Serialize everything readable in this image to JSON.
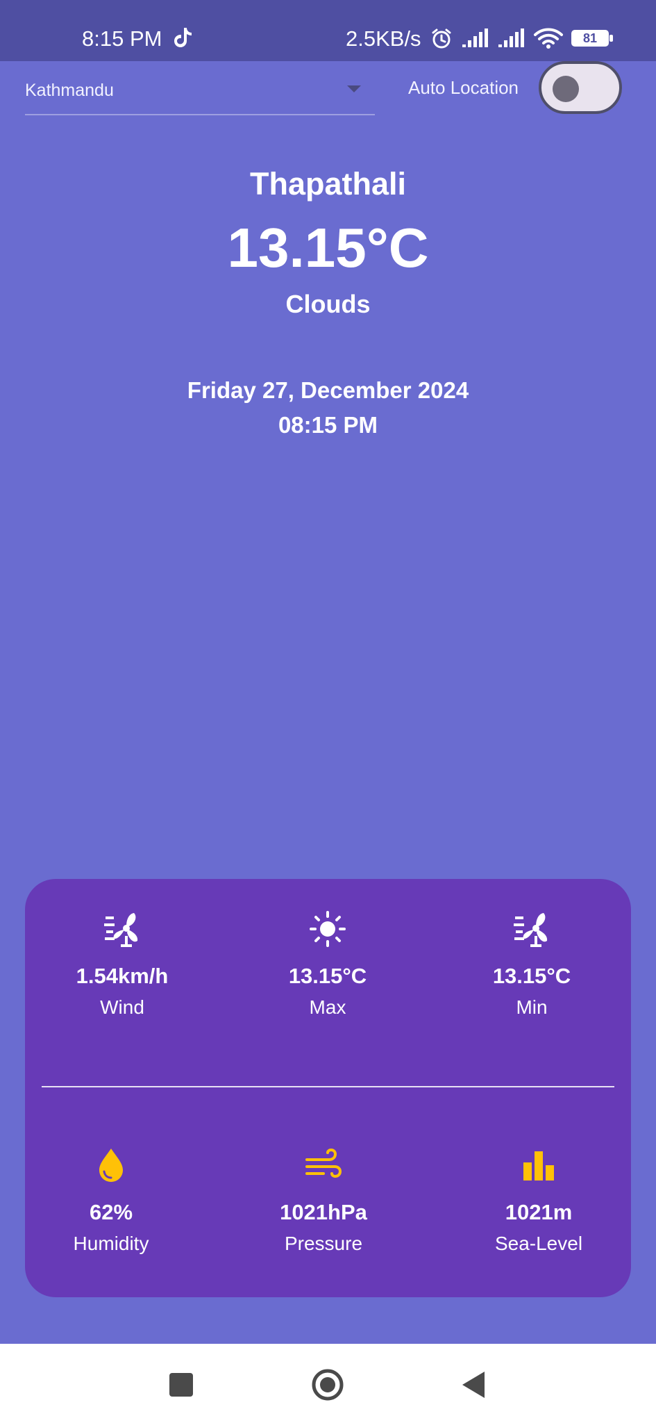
{
  "status_bar": {
    "time": "8:15 PM",
    "net_speed": "2.5KB/s",
    "battery": "81",
    "icons": [
      "tiktok-icon",
      "alarm-icon",
      "signal-icon",
      "signal-icon",
      "wifi-icon",
      "battery-icon"
    ]
  },
  "controls": {
    "location": "Kathmandu",
    "auto_location_label": "Auto Location",
    "auto_location_enabled": false
  },
  "weather": {
    "place": "Thapathali",
    "temperature": "13.15°C",
    "condition": "Clouds",
    "date": "Friday 27, December 2024",
    "time": "08:15 PM"
  },
  "stats": {
    "top": [
      {
        "value": "1.54km/h",
        "label": "Wind",
        "icon": "wind-fan-icon"
      },
      {
        "value": "13.15°C",
        "label": "Max",
        "icon": "sun-icon"
      },
      {
        "value": "13.15°C",
        "label": "Min",
        "icon": "wind-fan-icon"
      }
    ],
    "bottom": [
      {
        "value": "62%",
        "label": "Humidity",
        "icon": "water-drop-icon"
      },
      {
        "value": "1021hPa",
        "label": "Pressure",
        "icon": "air-icon"
      },
      {
        "value": "1021m",
        "label": "Sea-Level",
        "icon": "bar-chart-icon"
      }
    ]
  },
  "colors": {
    "background": "#6A6CD0",
    "status_bar": "#4F4FA2",
    "card": "#673AB7",
    "accent_icon": "#FFC107",
    "text": "#FFFFFF"
  },
  "nav_bar": {
    "buttons": [
      "recent-apps-icon",
      "home-icon",
      "back-icon"
    ]
  }
}
